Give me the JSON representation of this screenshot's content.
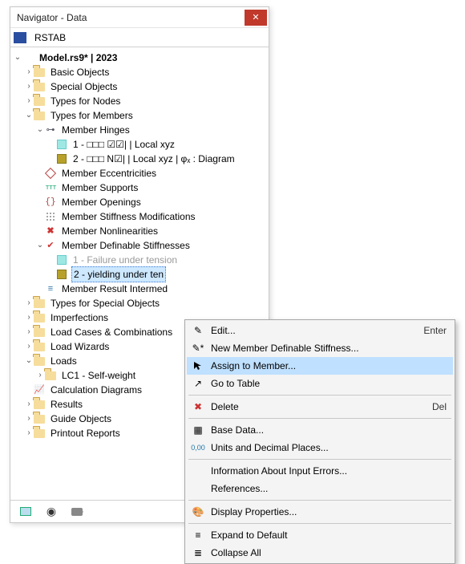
{
  "title": "Navigator - Data",
  "tab": "RSTAB",
  "root": "Model.rs9* | 2023",
  "tree": {
    "basic_objects": "Basic Objects",
    "special_objects": "Special Objects",
    "types_for_nodes": "Types for Nodes",
    "types_for_members": "Types for Members",
    "member_hinges": "Member Hinges",
    "hinge1": "1 - □□□ ☑☑| | Local xyz",
    "hinge2": "2 - □□□ N☑| | Local xyz | φₓ : Diagram",
    "member_eccentricities": "Member Eccentricities",
    "member_supports": "Member Supports",
    "member_openings": "Member Openings",
    "member_stiffness_mod": "Member Stiffness Modifications",
    "member_nonlinearities": "Member Nonlinearities",
    "member_def_stiff": "Member Definable Stiffnesses",
    "stiff1": "1 - Failure under tension",
    "stiff2": "2 - yielding under ten",
    "member_result_intermediate": "Member Result Intermed",
    "types_for_special": "Types for Special Objects",
    "imperfections": "Imperfections",
    "load_cases": "Load Cases & Combinations",
    "load_wizards": "Load Wizards",
    "loads": "Loads",
    "lc1": "LC1 - Self-weight",
    "calc_diagrams": "Calculation Diagrams",
    "results": "Results",
    "guide_objects": "Guide Objects",
    "printout_reports": "Printout Reports"
  },
  "ctx": {
    "edit": "Edit...",
    "edit_accel": "Enter",
    "new_def": "New Member Definable Stiffness...",
    "assign": "Assign to Member...",
    "goto_table": "Go to Table",
    "delete": "Delete",
    "delete_accel": "Del",
    "base_data": "Base Data...",
    "units": "Units and Decimal Places...",
    "info_errors": "Information About Input Errors...",
    "references": "References...",
    "display_props": "Display Properties...",
    "expand": "Expand to Default",
    "collapse": "Collapse All"
  }
}
